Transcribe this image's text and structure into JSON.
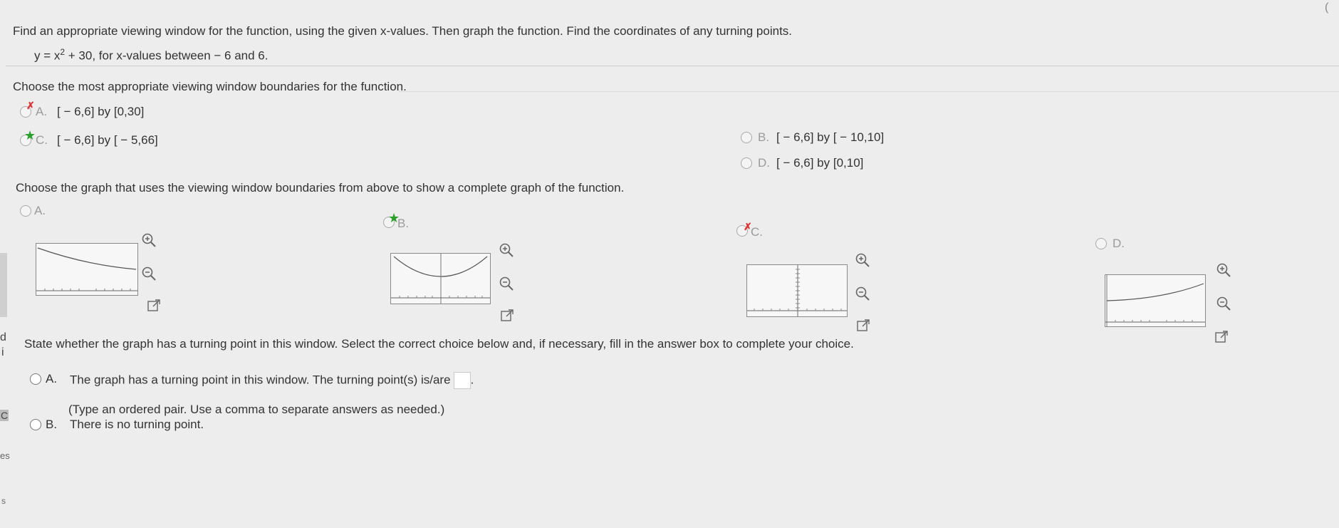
{
  "prompt": {
    "instruction": "Find an appropriate viewing window for the function, using the given x-values. Then graph the function. Find the coordinates of any turning points.",
    "function_y": "y = x",
    "function_exp": "2",
    "function_rest": " + 30, for x-values between − 6 and 6."
  },
  "q1": {
    "question": "Choose the most appropriate viewing window boundaries for the function.",
    "choices": [
      {
        "letter": "A.",
        "text": "[ − 6,6] by [0,30]",
        "state": "incorrect"
      },
      {
        "letter": "B.",
        "text": "[ − 6,6] by [ − 10,10]",
        "state": "unselected"
      },
      {
        "letter": "C.",
        "text": "[ − 6,6] by [ − 5,66]",
        "state": "correct"
      },
      {
        "letter": "D.",
        "text": "[ − 6,6] by [0,10]",
        "state": "unselected"
      }
    ]
  },
  "q2": {
    "question": "Choose the graph that uses the viewing window boundaries from above to show a complete graph of the function.",
    "choices": [
      {
        "letter": "A.",
        "state": "unselected"
      },
      {
        "letter": "B.",
        "state": "correct"
      },
      {
        "letter": "C.",
        "state": "incorrect"
      },
      {
        "letter": "D.",
        "state": "unselected"
      }
    ]
  },
  "q3": {
    "question": "State whether the graph has a turning point in this window. Select the correct choice below and, if necessary, fill in the answer box to complete your choice.",
    "choice_a_letter": "A.",
    "choice_a_text": "The graph has a turning point in this window. The turning point(s) is/are",
    "choice_a_hint": "(Type an ordered pair. Use a comma to separate answers as needed.)",
    "choice_b_letter": "B.",
    "choice_b_text": "There is no turning point.",
    "answer_value": ""
  },
  "left_edge": {
    "fragments": [
      "d",
      "i",
      "C",
      "es",
      "s"
    ]
  },
  "icons": {
    "zoom_in": "zoom-in-icon",
    "zoom_out": "zoom-out-icon",
    "expand": "expand-icon"
  }
}
